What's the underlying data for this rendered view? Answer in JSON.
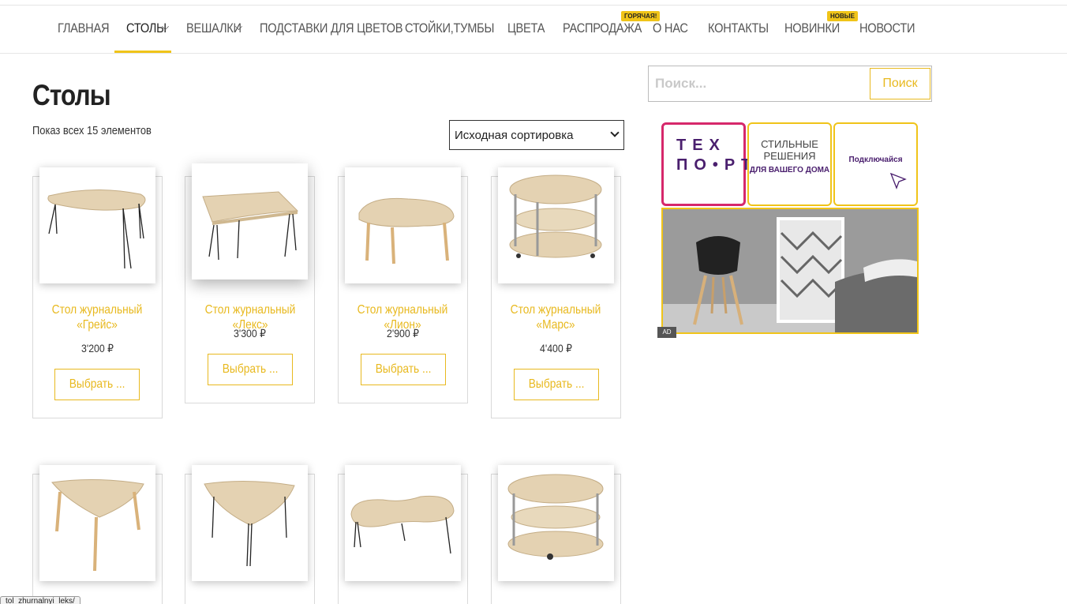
{
  "nav": {
    "items": [
      {
        "label": "ГЛАВНАЯ"
      },
      {
        "label": "СТОЛЫ"
      },
      {
        "label": "ВЕШАЛКИ"
      },
      {
        "label": "ПОДСТАВКИ ДЛЯ ЦВЕТОВ"
      },
      {
        "label": "СТОЙКИ,ТУМБЫ"
      },
      {
        "label": "ЦВЕТА"
      },
      {
        "label": "РАСПРОДАЖА"
      },
      {
        "label": "О НАС"
      },
      {
        "label": "КОНТАКТЫ"
      },
      {
        "label": "НОВИНКИ"
      },
      {
        "label": "НОВОСТИ"
      }
    ],
    "badges": {
      "sale": "ГОРЯЧАЯ!",
      "new": "НОВЫЕ"
    },
    "active": "СТОЛЫ"
  },
  "catalog": {
    "title": "Столы",
    "result_count": "Показ всех 15 элементов",
    "sort_selected": "Исходная сортировка"
  },
  "products": [
    {
      "name": "Стол журнальный «Грейс»",
      "price": "3'200 ₽",
      "button": "Выбрать ..."
    },
    {
      "name": "Стол журнальный «Лекс»",
      "price": "3'300 ₽",
      "button": "Выбрать ..."
    },
    {
      "name": "Стол журнальный «Лион»",
      "price": "2'900 ₽",
      "button": "Выбрать ..."
    },
    {
      "name": "Стол журнальный «Марс»",
      "price": "4'400 ₽",
      "button": "Выбрать ..."
    },
    {
      "name": "",
      "price": "",
      "button": ""
    },
    {
      "name": "",
      "price": "",
      "button": ""
    },
    {
      "name": "",
      "price": "",
      "button": ""
    },
    {
      "name": "",
      "price": "",
      "button": ""
    }
  ],
  "search": {
    "placeholder": "Поиск...",
    "button": "Поиск"
  },
  "ad": {
    "logo": "ТЕХ ПО•РТ",
    "tile2_line1": "СТИЛЬНЫЕ РЕШЕНИЯ",
    "tile2_line2": "ДЛЯ ВАШЕГО ДОМА",
    "tile3": "Подключайся",
    "mark": "AD"
  },
  "status_url": "tol_zhurnalnyi_leks/",
  "colors": {
    "accent": "#f0c419",
    "link": "#e8b91f",
    "brand": "#4a1f6e",
    "brand_border": "#d6286b"
  }
}
